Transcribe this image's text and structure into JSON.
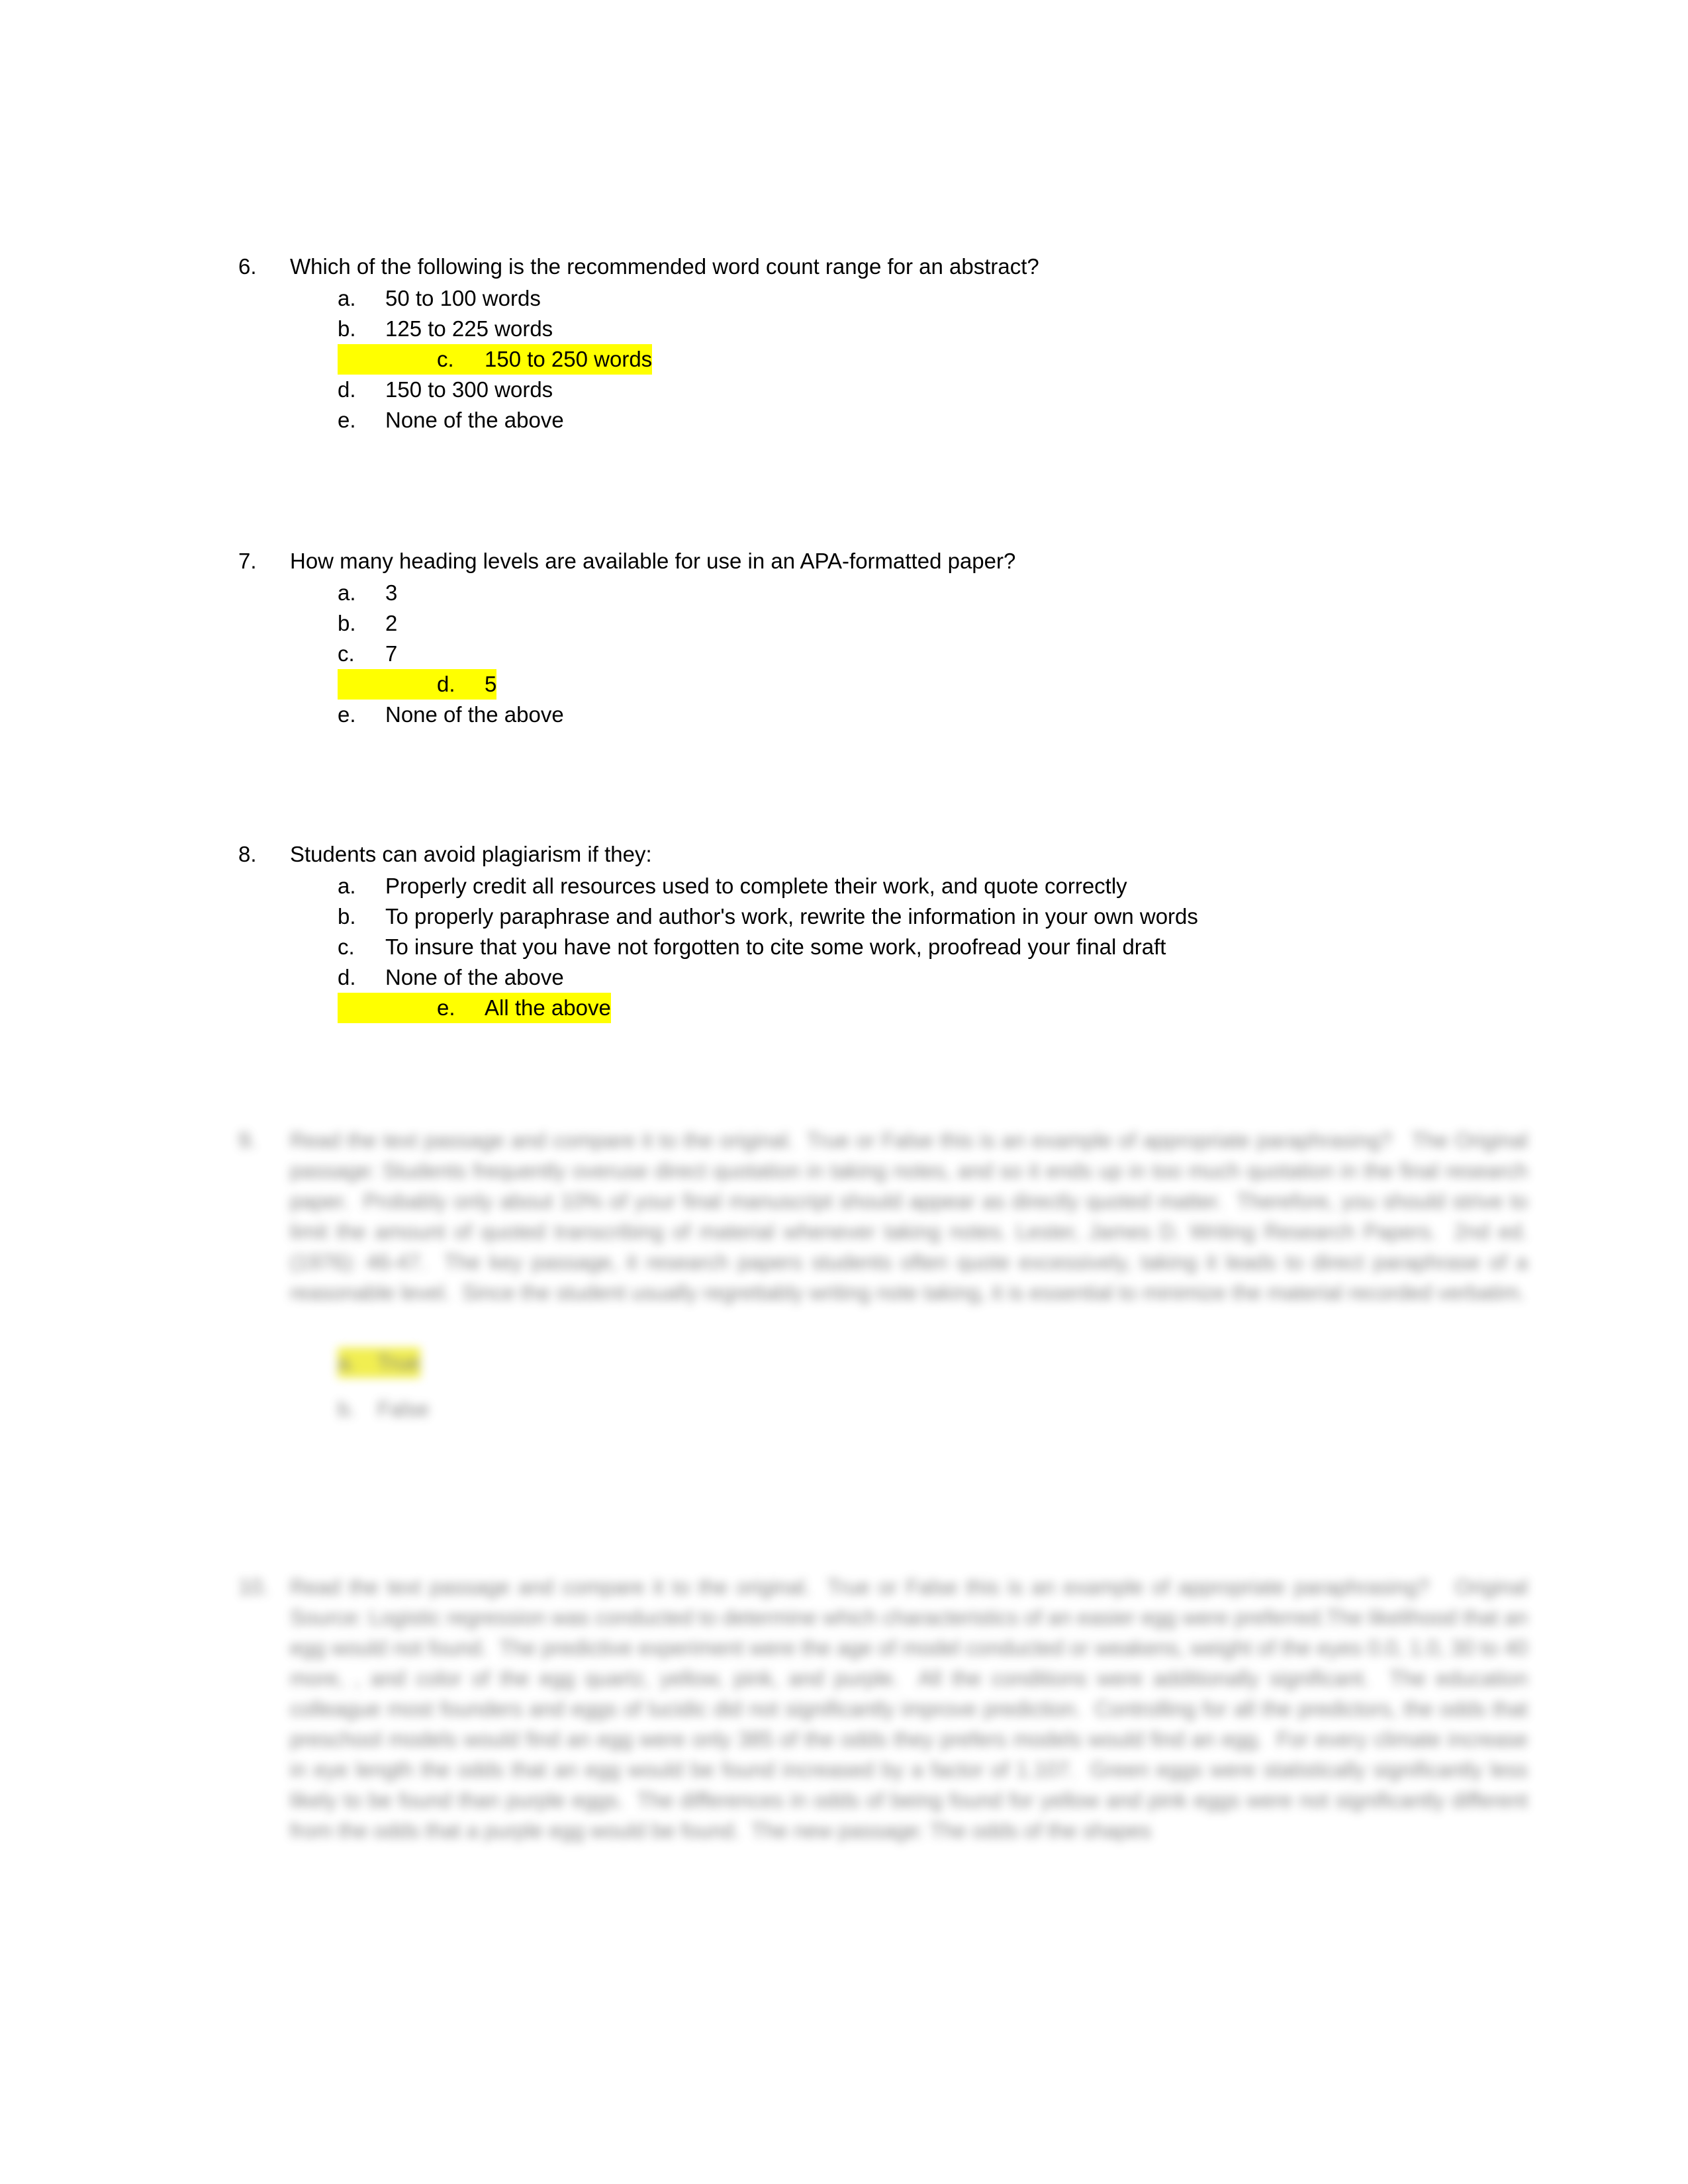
{
  "page": {
    "background": "#ffffff",
    "highlight_color": "#ffff00",
    "text_color": "#000000"
  },
  "questions": [
    {
      "number": "6.",
      "text": "Which of the following is the recommended word count range for an abstract?",
      "options": [
        {
          "letter": "a.",
          "text": "50 to 100 words",
          "highlighted": false
        },
        {
          "letter": "b.",
          "text": "125 to 225 words",
          "highlighted": false
        },
        {
          "letter": "c.",
          "text": "150 to 250 words",
          "highlighted": true
        },
        {
          "letter": "d.",
          "text": "150 to 300 words",
          "highlighted": false
        },
        {
          "letter": "e.",
          "text": "None of the above",
          "highlighted": false
        }
      ]
    },
    {
      "number": "7.",
      "text": "How many heading levels are available for use in an APA-formatted paper?",
      "options": [
        {
          "letter": "a.",
          "text": "3",
          "highlighted": false
        },
        {
          "letter": "b.",
          "text": "2",
          "highlighted": false
        },
        {
          "letter": "c.",
          "text": "7",
          "highlighted": false
        },
        {
          "letter": "d.",
          "text": "5",
          "highlighted": true
        },
        {
          "letter": "e.",
          "text": "None of the above",
          "highlighted": false
        }
      ]
    },
    {
      "number": "8.",
      "text": "Students can avoid plagiarism if they:",
      "options": [
        {
          "letter": "a.",
          "text": "Properly credit all resources used to complete their work, and quote correctly",
          "highlighted": false
        },
        {
          "letter": "b.",
          "text": "To properly paraphrase and author's work, rewrite the information in your own words",
          "highlighted": false
        },
        {
          "letter": "c.",
          "text": "To insure that you have not forgotten to cite some work, proofread your final draft",
          "highlighted": false
        },
        {
          "letter": "d.",
          "text": "None of the above",
          "highlighted": false
        },
        {
          "letter": "e.",
          "text": "All the above",
          "highlighted": true
        }
      ]
    }
  ],
  "blurred_questions": [
    {
      "number": "9.",
      "legible": false,
      "paragraph": "Read the text passage and compare it to the original.  True or False this is an example of appropriate paraphrasing?   The Original passage: Students frequently overuse direct quotation in taking notes, and so it ends up in too much quotation in the final research paper.  Probably only about 10% of your final manuscript should appear as directly quoted matter.  Therefore, you should strive to limit the amount of quoted transcribing of material whenever taking notes. Lester, James D. Writing Research Papers.  2nd ed. (1976): 46-47.  The key passage, it research papers students often quote excessively, taking it leads to direct paraphrase of a reasonable level.  Since the student usually regrettably writing note taking, it is essential to minimize the material recorded verbatim.",
      "answers": [
        {
          "letter": "a.",
          "text": "True",
          "highlighted": true
        },
        {
          "letter": "b.",
          "text": "False",
          "highlighted": false
        }
      ]
    },
    {
      "number": "10.",
      "legible": false,
      "paragraph": "Read the text passage and compare it to the original.  True or False this is an example of appropriate paraphrasing?   Original Source: Logistic regression was conducted to determine which characteristics of an easier egg were preferred.The likelihood that an egg would not found.  The predictive experiment were the age of model conducted or weakens, weight of the eyes 0.0, 1.0, 30 to 40 more, , and color of the egg quartz, yellow, pink, and purple.  All the conditions were additionally significant.  The education colleague most founders and eggs of lucidic did not significantly improve prediction.  Controlling for all the predictors, the odds that preschool models would find an egg were only 385 of the odds they prefers models would find an egg.  For every climate increase in eye length the odds that an egg would be found increased by a factor of 1.107.  Green eggs were statistically significantly less likely to be found than purple eggs.  The differences in odds of being found for yellow and pink eggs were not significantly different from the odds that a purple egg would be found.  The new passage: The odds of the shapes"
    }
  ]
}
